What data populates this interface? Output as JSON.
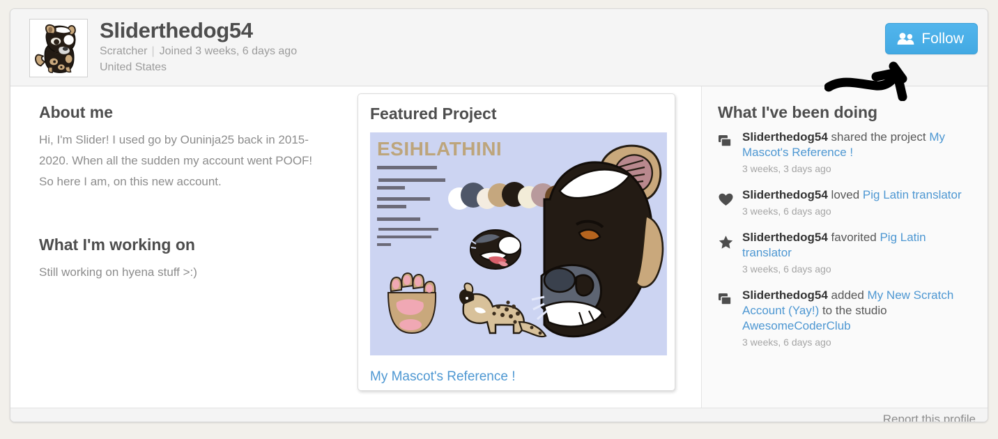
{
  "profile": {
    "username": "Sliderthedog54",
    "role": "Scratcher",
    "joined": "Joined 3 weeks, 6 days ago",
    "location": "United States",
    "avatar_alt": "hyena-avatar"
  },
  "follow": {
    "label": "Follow",
    "icon": "two-people-icon",
    "color": "#47ade8"
  },
  "annotation": {
    "type": "hand-drawn-arrow",
    "color": "#000000",
    "points_to": "follow-button"
  },
  "about": {
    "title": "About me",
    "text": "Hi, I'm Slider! I used go by Ouninja25 back in 2015-2020. When all the sudden my account went POOF! So here I am, on this new account."
  },
  "working_on": {
    "title": "What I'm working on",
    "text": "Still working on hyena stuff >:)"
  },
  "featured": {
    "title": "Featured Project",
    "project_name": "My Mascot's Reference !",
    "thumb_heading": "ESIHLATHINI",
    "thumb_bg": "#ccd4f2",
    "thumb_lines": [
      "SPOTTED HYENA",
      "SMALL BUT POSSIBLY",
      "SNAPPY",
      "RESPONDS WELL",
      "TO FRIENDS",
      "MODERN FAVE",
      "SLIDER HAS A HINT OF",
      "HE AND SHE I BYE",
      "SUN"
    ]
  },
  "activity": {
    "title": "What I've been doing",
    "items": [
      {
        "icon": "project-stack-icon",
        "user": "Sliderthedog54",
        "action": " shared the project ",
        "link": "My Mascot's Reference !",
        "tail": "",
        "link2": "",
        "time": "3 weeks, 3 days ago"
      },
      {
        "icon": "heart-icon",
        "user": "Sliderthedog54",
        "action": " loved ",
        "link": "Pig Latin translator",
        "tail": "",
        "link2": "",
        "time": "3 weeks, 6 days ago"
      },
      {
        "icon": "star-icon",
        "user": "Sliderthedog54",
        "action": " favorited ",
        "link": "Pig Latin translator",
        "tail": "",
        "link2": "",
        "time": "3 weeks, 6 days ago"
      },
      {
        "icon": "project-stack-icon",
        "user": "Sliderthedog54",
        "action": " added ",
        "link": "My New Scratch Account (Yay!)",
        "tail": " to the studio ",
        "link2": "AwesomeCoderClub",
        "time": "3 weeks, 6 days ago"
      }
    ]
  },
  "footer": {
    "report_label": "Report this profile"
  }
}
